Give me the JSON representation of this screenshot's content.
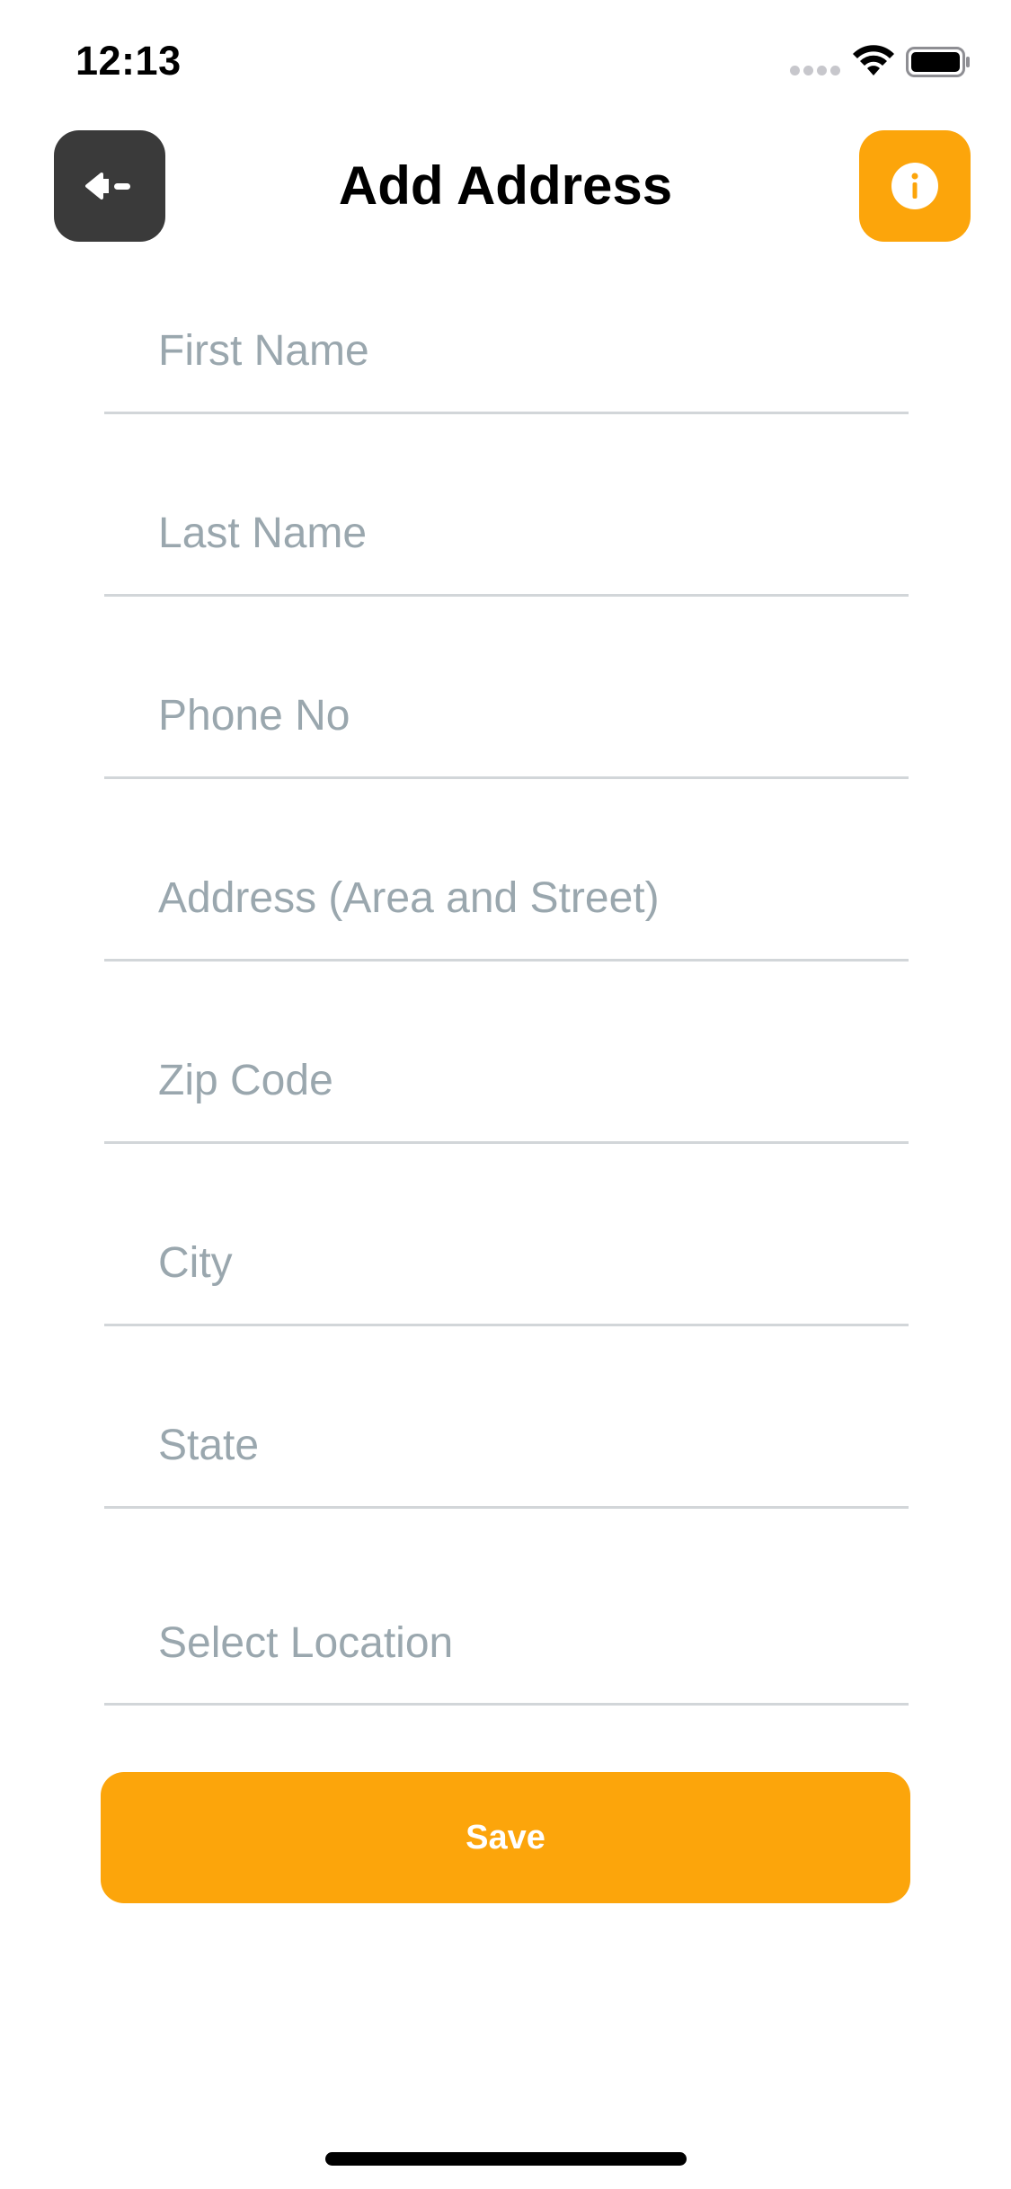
{
  "status_bar": {
    "time": "12:13",
    "signal_icon": "signal-dots-icon",
    "wifi_icon": "wifi-icon",
    "battery_icon": "battery-icon"
  },
  "header": {
    "title": "Add Address",
    "back_icon": "back-arrow-icon",
    "info_icon": "info-icon"
  },
  "form": {
    "fields": [
      {
        "name": "first-name",
        "placeholder": "First Name",
        "value": ""
      },
      {
        "name": "last-name",
        "placeholder": "Last Name",
        "value": ""
      },
      {
        "name": "phone-no",
        "placeholder": "Phone No",
        "value": ""
      },
      {
        "name": "address",
        "placeholder": "Address (Area and Street)",
        "value": ""
      },
      {
        "name": "zip-code",
        "placeholder": "Zip Code",
        "value": ""
      },
      {
        "name": "city",
        "placeholder": "City",
        "value": ""
      },
      {
        "name": "state",
        "placeholder": "State",
        "value": ""
      },
      {
        "name": "select-location",
        "placeholder": "Select Location",
        "value": ""
      }
    ],
    "save_label": "Save"
  },
  "colors": {
    "accent": "#fca50b",
    "back_button_bg": "#3a3a3a",
    "placeholder": "#9aa7ae",
    "divider": "#d2d6d9"
  }
}
